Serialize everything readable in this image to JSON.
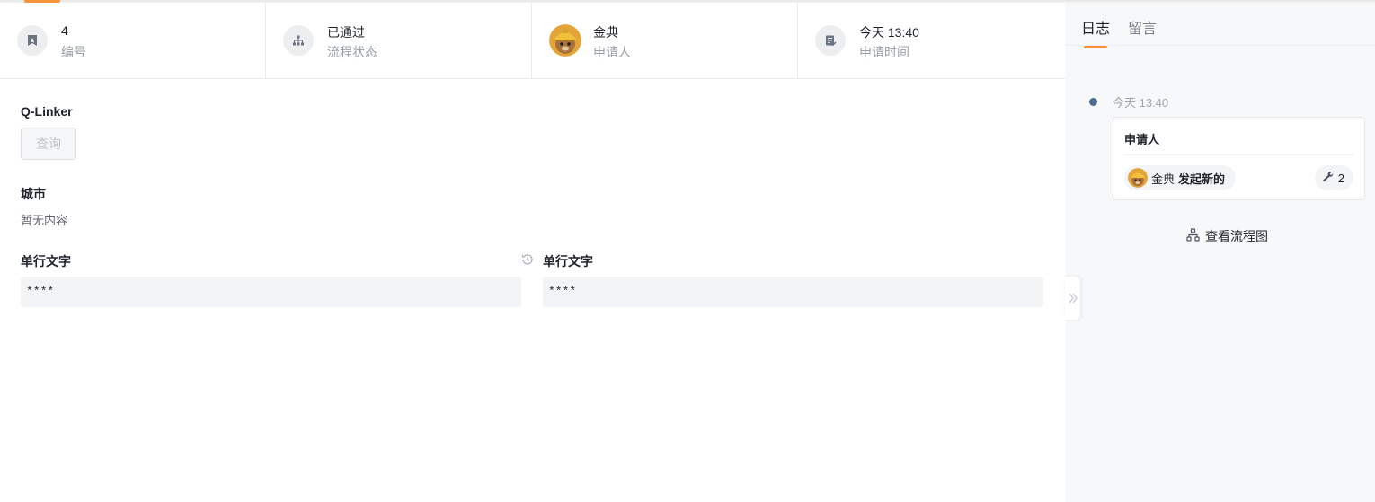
{
  "info": {
    "number": {
      "value": "4",
      "label": "编号"
    },
    "status": {
      "value": "已通过",
      "label": "流程状态"
    },
    "applicant": {
      "value": "金典",
      "label": "申请人"
    },
    "time": {
      "value": "今天 13:40",
      "label": "申请时间"
    }
  },
  "form": {
    "qlinker_label": "Q-Linker",
    "query_button": "查询",
    "city_label": "城市",
    "city_empty": "暂无内容",
    "field1_label": "单行文字",
    "field1_value": "****",
    "field2_label": "单行文字",
    "field2_value": "****"
  },
  "side": {
    "tabs": [
      {
        "label": "日志"
      },
      {
        "label": "留言"
      }
    ],
    "log": {
      "time": "今天 13:40",
      "title": "申请人",
      "user": "金典",
      "action": "发起新的",
      "count": "2"
    },
    "flow_link": "查看流程图"
  },
  "colors": {
    "accent": "#f7933b",
    "timeline_dot": "#4e6d91"
  },
  "icons": {
    "number": "bookmark-icon",
    "status": "flow-tree-icon",
    "time": "edit-note-icon",
    "history": "history-clock-icon",
    "wrench": "wrench-icon",
    "flow": "flowchart-icon",
    "collapse": "double-chevron-right-icon"
  }
}
